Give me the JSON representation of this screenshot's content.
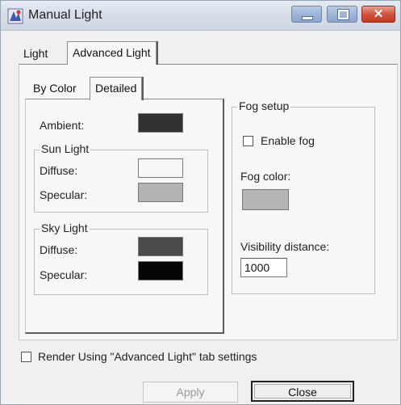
{
  "window": {
    "title": "Manual Light"
  },
  "tabs": [
    {
      "label": "Light"
    },
    {
      "label": "Advanced Light"
    }
  ],
  "subtabs": [
    {
      "label": "By Color"
    },
    {
      "label": "Detailed"
    }
  ],
  "detailed": {
    "ambient_label": "Ambient:",
    "ambient_color": "#323232",
    "sun_light": {
      "title": "Sun Light",
      "diffuse_label": "Diffuse:",
      "diffuse_color": "#f8f8f8",
      "specular_label": "Specular:",
      "specular_color": "#b3b3b3"
    },
    "sky_light": {
      "title": "Sky Light",
      "diffuse_label": "Diffuse:",
      "diffuse_color": "#4a4a4a",
      "specular_label": "Specular:",
      "specular_color": "#050505"
    }
  },
  "fog": {
    "title": "Fog setup",
    "enable_label": "Enable fog",
    "enable_checked": false,
    "color_label": "Fog color:",
    "color": "#b5b5b5",
    "visibility_label": "Visibility distance:",
    "visibility_value": "1000"
  },
  "footer": {
    "render_label": "Render Using \"Advanced Light\" tab settings",
    "render_checked": false,
    "apply_label": "Apply",
    "close_label": "Close"
  }
}
